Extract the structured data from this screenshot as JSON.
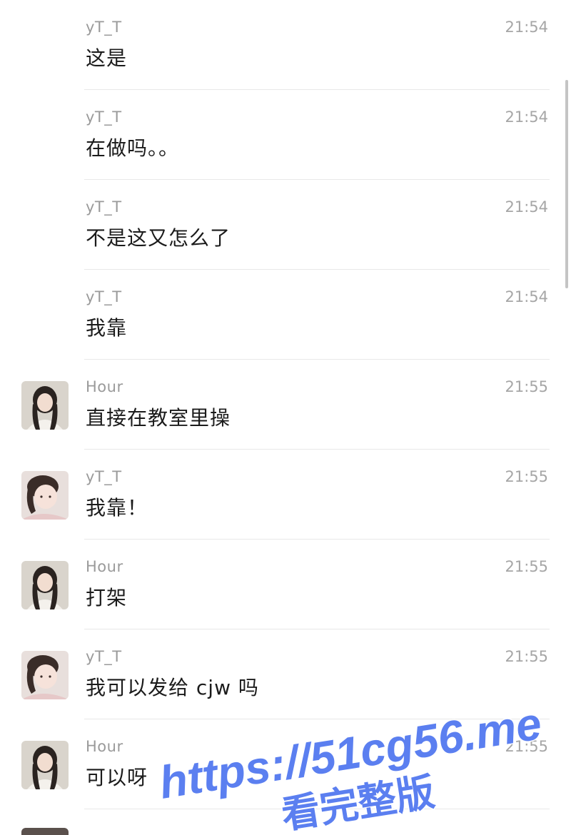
{
  "messages": [
    {
      "sender": "yT_T",
      "time": "21:54",
      "text": "这是",
      "avatar": "none"
    },
    {
      "sender": "yT_T",
      "time": "21:54",
      "text": "在做吗。。",
      "avatar": "none"
    },
    {
      "sender": "yT_T",
      "time": "21:54",
      "text": "不是这又怎么了",
      "avatar": "none"
    },
    {
      "sender": "yT_T",
      "time": "21:54",
      "text": "我靠",
      "avatar": "none"
    },
    {
      "sender": "Hour",
      "time": "21:55",
      "text": "直接在教室里操",
      "avatar": "hour"
    },
    {
      "sender": "yT_T",
      "time": "21:55",
      "text": "我靠！",
      "avatar": "yt"
    },
    {
      "sender": "Hour",
      "time": "21:55",
      "text": "打架",
      "avatar": "hour"
    },
    {
      "sender": "yT_T",
      "time": "21:55",
      "text": "我可以发给 cjw 吗",
      "avatar": "yt"
    },
    {
      "sender": "Hour",
      "time": "21:55",
      "text": "可以呀",
      "avatar": "hour"
    }
  ],
  "watermark": {
    "url": "https://51cg56.me",
    "caption": "看完整版",
    "color": "#5b7ff0"
  }
}
